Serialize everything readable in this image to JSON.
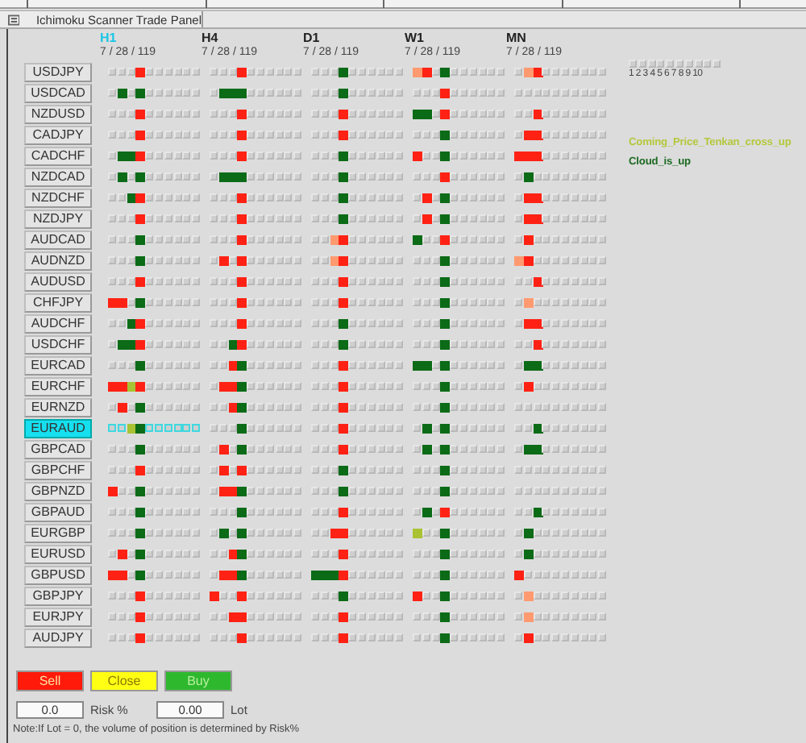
{
  "window": {
    "title": "Ichimoku Scanner Trade Panel"
  },
  "timeframes": [
    {
      "label": "H1",
      "selected": true,
      "periods": "7 / 28 / 119"
    },
    {
      "label": "H4",
      "selected": false,
      "periods": "7 / 28 / 119"
    },
    {
      "label": "D1",
      "selected": false,
      "periods": "7 / 28 / 119"
    },
    {
      "label": "W1",
      "selected": false,
      "periods": "7 / 28 / 119"
    },
    {
      "label": "MN",
      "selected": false,
      "periods": "7 / 28 / 119"
    }
  ],
  "legend": {
    "numbers": "1 2 3 4 5 6 7 8 9 10"
  },
  "signals": [
    {
      "label": "Coming_Price_Tenkan_cross_up",
      "color": "#b4c83c"
    },
    {
      "label": "Cloud_is_up",
      "color": "#1d6a22"
    }
  ],
  "pairs": [
    {
      "symbol": "USDJPY",
      "selected": false,
      "cells": [
        [
          {
            "kind": "off"
          },
          {
            "kind": "off"
          },
          {
            "kind": "off"
          },
          {
            "kind": "red"
          }
        ],
        [
          {
            "kind": "off"
          },
          {
            "kind": "off"
          },
          {
            "kind": "off"
          },
          {
            "kind": "red"
          }
        ],
        [
          {
            "kind": "off"
          },
          {
            "kind": "off"
          },
          {
            "kind": "off"
          },
          {
            "kind": "green"
          }
        ],
        [
          {
            "kind": "orange"
          },
          {
            "kind": "red"
          },
          {
            "kind": "off"
          },
          {
            "kind": "green"
          }
        ],
        [
          {
            "kind": "off"
          },
          {
            "kind": "orange"
          },
          {
            "kind": "red"
          },
          {
            "kind": "off"
          }
        ]
      ]
    },
    {
      "symbol": "USDCAD",
      "selected": false,
      "cells": [
        [
          {
            "kind": "off"
          },
          {
            "kind": "green"
          },
          {
            "kind": "off"
          },
          {
            "kind": "green"
          }
        ],
        [
          {
            "kind": "off"
          },
          {
            "kind": "green"
          },
          {
            "kind": "green"
          },
          {
            "kind": "green"
          }
        ],
        [
          {
            "kind": "off"
          },
          {
            "kind": "off"
          },
          {
            "kind": "off"
          },
          {
            "kind": "green"
          }
        ],
        [
          {
            "kind": "off"
          },
          {
            "kind": "off"
          },
          {
            "kind": "off"
          },
          {
            "kind": "red"
          }
        ],
        [
          {
            "kind": "off"
          },
          {
            "kind": "off"
          },
          {
            "kind": "off"
          },
          {
            "kind": "off"
          }
        ]
      ]
    },
    {
      "symbol": "NZDUSD",
      "selected": false,
      "cells": [
        [
          {
            "kind": "off"
          },
          {
            "kind": "off"
          },
          {
            "kind": "off"
          },
          {
            "kind": "red"
          }
        ],
        [
          {
            "kind": "off"
          },
          {
            "kind": "off"
          },
          {
            "kind": "off"
          },
          {
            "kind": "red"
          }
        ],
        [
          {
            "kind": "off"
          },
          {
            "kind": "off"
          },
          {
            "kind": "off"
          },
          {
            "kind": "red"
          }
        ],
        [
          {
            "kind": "green"
          },
          {
            "kind": "green"
          },
          {
            "kind": "off"
          },
          {
            "kind": "red"
          }
        ],
        [
          {
            "kind": "off"
          },
          {
            "kind": "off"
          },
          {
            "kind": "red"
          },
          {
            "kind": "off"
          }
        ]
      ]
    },
    {
      "symbol": "CADJPY",
      "selected": false,
      "cells": [
        [
          {
            "kind": "off"
          },
          {
            "kind": "off"
          },
          {
            "kind": "off"
          },
          {
            "kind": "red"
          }
        ],
        [
          {
            "kind": "off"
          },
          {
            "kind": "off"
          },
          {
            "kind": "off"
          },
          {
            "kind": "red"
          }
        ],
        [
          {
            "kind": "off"
          },
          {
            "kind": "off"
          },
          {
            "kind": "off"
          },
          {
            "kind": "red"
          }
        ],
        [
          {
            "kind": "off"
          },
          {
            "kind": "off"
          },
          {
            "kind": "off"
          },
          {
            "kind": "green"
          }
        ],
        [
          {
            "kind": "off"
          },
          {
            "kind": "red"
          },
          {
            "kind": "red"
          },
          {
            "kind": "off"
          }
        ]
      ]
    },
    {
      "symbol": "CADCHF",
      "selected": false,
      "cells": [
        [
          {
            "kind": "off"
          },
          {
            "kind": "green"
          },
          {
            "kind": "green"
          },
          {
            "kind": "red"
          }
        ],
        [
          {
            "kind": "off"
          },
          {
            "kind": "off"
          },
          {
            "kind": "off"
          },
          {
            "kind": "red"
          }
        ],
        [
          {
            "kind": "off"
          },
          {
            "kind": "off"
          },
          {
            "kind": "off"
          },
          {
            "kind": "green"
          }
        ],
        [
          {
            "kind": "red"
          },
          {
            "kind": "off"
          },
          {
            "kind": "off"
          },
          {
            "kind": "green"
          }
        ],
        [
          {
            "kind": "red"
          },
          {
            "kind": "red"
          },
          {
            "kind": "red"
          },
          {
            "kind": "off"
          }
        ]
      ]
    },
    {
      "symbol": "NZDCAD",
      "selected": false,
      "cells": [
        [
          {
            "kind": "off"
          },
          {
            "kind": "green"
          },
          {
            "kind": "off"
          },
          {
            "kind": "green"
          }
        ],
        [
          {
            "kind": "off"
          },
          {
            "kind": "green"
          },
          {
            "kind": "green"
          },
          {
            "kind": "green"
          }
        ],
        [
          {
            "kind": "off"
          },
          {
            "kind": "off"
          },
          {
            "kind": "off"
          },
          {
            "kind": "green"
          }
        ],
        [
          {
            "kind": "off"
          },
          {
            "kind": "off"
          },
          {
            "kind": "off"
          },
          {
            "kind": "red"
          }
        ],
        [
          {
            "kind": "off"
          },
          {
            "kind": "green"
          },
          {
            "kind": "off"
          },
          {
            "kind": "off"
          }
        ]
      ]
    },
    {
      "symbol": "NZDCHF",
      "selected": false,
      "cells": [
        [
          {
            "kind": "off"
          },
          {
            "kind": "off"
          },
          {
            "kind": "green"
          },
          {
            "kind": "red"
          }
        ],
        [
          {
            "kind": "off"
          },
          {
            "kind": "off"
          },
          {
            "kind": "off"
          },
          {
            "kind": "red"
          }
        ],
        [
          {
            "kind": "off"
          },
          {
            "kind": "off"
          },
          {
            "kind": "off"
          },
          {
            "kind": "green"
          }
        ],
        [
          {
            "kind": "off"
          },
          {
            "kind": "red"
          },
          {
            "kind": "off"
          },
          {
            "kind": "green"
          }
        ],
        [
          {
            "kind": "off"
          },
          {
            "kind": "red"
          },
          {
            "kind": "red"
          },
          {
            "kind": "off"
          }
        ]
      ]
    },
    {
      "symbol": "NZDJPY",
      "selected": false,
      "cells": [
        [
          {
            "kind": "off"
          },
          {
            "kind": "off"
          },
          {
            "kind": "off"
          },
          {
            "kind": "red"
          }
        ],
        [
          {
            "kind": "off"
          },
          {
            "kind": "off"
          },
          {
            "kind": "off"
          },
          {
            "kind": "red"
          }
        ],
        [
          {
            "kind": "off"
          },
          {
            "kind": "off"
          },
          {
            "kind": "off"
          },
          {
            "kind": "green"
          }
        ],
        [
          {
            "kind": "off"
          },
          {
            "kind": "red"
          },
          {
            "kind": "off"
          },
          {
            "kind": "green"
          }
        ],
        [
          {
            "kind": "off"
          },
          {
            "kind": "red"
          },
          {
            "kind": "red"
          },
          {
            "kind": "off"
          }
        ]
      ]
    },
    {
      "symbol": "AUDCAD",
      "selected": false,
      "cells": [
        [
          {
            "kind": "off"
          },
          {
            "kind": "off"
          },
          {
            "kind": "off"
          },
          {
            "kind": "green"
          }
        ],
        [
          {
            "kind": "off"
          },
          {
            "kind": "off"
          },
          {
            "kind": "off"
          },
          {
            "kind": "red"
          }
        ],
        [
          {
            "kind": "off"
          },
          {
            "kind": "off"
          },
          {
            "kind": "orange"
          },
          {
            "kind": "red"
          }
        ],
        [
          {
            "kind": "green"
          },
          {
            "kind": "off"
          },
          {
            "kind": "off"
          },
          {
            "kind": "red"
          }
        ],
        [
          {
            "kind": "off"
          },
          {
            "kind": "red"
          },
          {
            "kind": "off"
          },
          {
            "kind": "off"
          }
        ]
      ]
    },
    {
      "symbol": "AUDNZD",
      "selected": false,
      "cells": [
        [
          {
            "kind": "off"
          },
          {
            "kind": "off"
          },
          {
            "kind": "off"
          },
          {
            "kind": "green"
          }
        ],
        [
          {
            "kind": "off"
          },
          {
            "kind": "red"
          },
          {
            "kind": "off"
          },
          {
            "kind": "red"
          }
        ],
        [
          {
            "kind": "off"
          },
          {
            "kind": "off"
          },
          {
            "kind": "orange"
          },
          {
            "kind": "red"
          }
        ],
        [
          {
            "kind": "off"
          },
          {
            "kind": "off"
          },
          {
            "kind": "off"
          },
          {
            "kind": "green"
          }
        ],
        [
          {
            "kind": "orange"
          },
          {
            "kind": "red"
          },
          {
            "kind": "off"
          },
          {
            "kind": "off"
          }
        ]
      ]
    },
    {
      "symbol": "AUDUSD",
      "selected": false,
      "cells": [
        [
          {
            "kind": "off"
          },
          {
            "kind": "off"
          },
          {
            "kind": "off"
          },
          {
            "kind": "red"
          }
        ],
        [
          {
            "kind": "off"
          },
          {
            "kind": "off"
          },
          {
            "kind": "off"
          },
          {
            "kind": "red"
          }
        ],
        [
          {
            "kind": "off"
          },
          {
            "kind": "off"
          },
          {
            "kind": "off"
          },
          {
            "kind": "red"
          }
        ],
        [
          {
            "kind": "off"
          },
          {
            "kind": "off"
          },
          {
            "kind": "off"
          },
          {
            "kind": "green"
          }
        ],
        [
          {
            "kind": "off"
          },
          {
            "kind": "off"
          },
          {
            "kind": "red"
          },
          {
            "kind": "off"
          }
        ]
      ]
    },
    {
      "symbol": "CHFJPY",
      "selected": false,
      "cells": [
        [
          {
            "kind": "red"
          },
          {
            "kind": "red"
          },
          {
            "kind": "off"
          },
          {
            "kind": "green"
          }
        ],
        [
          {
            "kind": "off"
          },
          {
            "kind": "off"
          },
          {
            "kind": "off"
          },
          {
            "kind": "red"
          }
        ],
        [
          {
            "kind": "off"
          },
          {
            "kind": "off"
          },
          {
            "kind": "off"
          },
          {
            "kind": "red"
          }
        ],
        [
          {
            "kind": "off"
          },
          {
            "kind": "off"
          },
          {
            "kind": "off"
          },
          {
            "kind": "green"
          }
        ],
        [
          {
            "kind": "off"
          },
          {
            "kind": "orange"
          },
          {
            "kind": "off"
          },
          {
            "kind": "off"
          }
        ]
      ]
    },
    {
      "symbol": "AUDCHF",
      "selected": false,
      "cells": [
        [
          {
            "kind": "off"
          },
          {
            "kind": "off"
          },
          {
            "kind": "green"
          },
          {
            "kind": "red"
          }
        ],
        [
          {
            "kind": "off"
          },
          {
            "kind": "off"
          },
          {
            "kind": "off"
          },
          {
            "kind": "red"
          }
        ],
        [
          {
            "kind": "off"
          },
          {
            "kind": "off"
          },
          {
            "kind": "off"
          },
          {
            "kind": "green"
          }
        ],
        [
          {
            "kind": "off"
          },
          {
            "kind": "off"
          },
          {
            "kind": "off"
          },
          {
            "kind": "green"
          }
        ],
        [
          {
            "kind": "off"
          },
          {
            "kind": "red"
          },
          {
            "kind": "red"
          },
          {
            "kind": "off"
          }
        ]
      ]
    },
    {
      "symbol": "USDCHF",
      "selected": false,
      "cells": [
        [
          {
            "kind": "off"
          },
          {
            "kind": "green"
          },
          {
            "kind": "green"
          },
          {
            "kind": "red"
          }
        ],
        [
          {
            "kind": "off"
          },
          {
            "kind": "off"
          },
          {
            "kind": "green"
          },
          {
            "kind": "red"
          }
        ],
        [
          {
            "kind": "off"
          },
          {
            "kind": "off"
          },
          {
            "kind": "off"
          },
          {
            "kind": "green"
          }
        ],
        [
          {
            "kind": "off"
          },
          {
            "kind": "off"
          },
          {
            "kind": "off"
          },
          {
            "kind": "green"
          }
        ],
        [
          {
            "kind": "off"
          },
          {
            "kind": "off"
          },
          {
            "kind": "red"
          },
          {
            "kind": "off"
          }
        ]
      ]
    },
    {
      "symbol": "EURCAD",
      "selected": false,
      "cells": [
        [
          {
            "kind": "off"
          },
          {
            "kind": "off"
          },
          {
            "kind": "off"
          },
          {
            "kind": "green"
          }
        ],
        [
          {
            "kind": "off"
          },
          {
            "kind": "off"
          },
          {
            "kind": "red"
          },
          {
            "kind": "green"
          }
        ],
        [
          {
            "kind": "off"
          },
          {
            "kind": "off"
          },
          {
            "kind": "off"
          },
          {
            "kind": "red"
          }
        ],
        [
          {
            "kind": "green"
          },
          {
            "kind": "green"
          },
          {
            "kind": "off"
          },
          {
            "kind": "green"
          }
        ],
        [
          {
            "kind": "off"
          },
          {
            "kind": "green"
          },
          {
            "kind": "green"
          },
          {
            "kind": "off"
          }
        ]
      ]
    },
    {
      "symbol": "EURCHF",
      "selected": false,
      "cells": [
        [
          {
            "kind": "red"
          },
          {
            "kind": "red"
          },
          {
            "kind": "lime"
          },
          {
            "kind": "red"
          }
        ],
        [
          {
            "kind": "off"
          },
          {
            "kind": "red"
          },
          {
            "kind": "red"
          },
          {
            "kind": "green"
          }
        ],
        [
          {
            "kind": "off"
          },
          {
            "kind": "off"
          },
          {
            "kind": "off"
          },
          {
            "kind": "red"
          }
        ],
        [
          {
            "kind": "off"
          },
          {
            "kind": "off"
          },
          {
            "kind": "off"
          },
          {
            "kind": "green"
          }
        ],
        [
          {
            "kind": "off"
          },
          {
            "kind": "red"
          },
          {
            "kind": "off"
          },
          {
            "kind": "off"
          }
        ]
      ]
    },
    {
      "symbol": "EURNZD",
      "selected": false,
      "cells": [
        [
          {
            "kind": "off"
          },
          {
            "kind": "red"
          },
          {
            "kind": "off"
          },
          {
            "kind": "green"
          }
        ],
        [
          {
            "kind": "off"
          },
          {
            "kind": "off"
          },
          {
            "kind": "red"
          },
          {
            "kind": "green"
          }
        ],
        [
          {
            "kind": "off"
          },
          {
            "kind": "off"
          },
          {
            "kind": "off"
          },
          {
            "kind": "red"
          }
        ],
        [
          {
            "kind": "off"
          },
          {
            "kind": "off"
          },
          {
            "kind": "off"
          },
          {
            "kind": "green"
          }
        ],
        [
          {
            "kind": "off"
          },
          {
            "kind": "off"
          },
          {
            "kind": "off"
          },
          {
            "kind": "off"
          }
        ]
      ]
    },
    {
      "symbol": "EURAUD",
      "selected": true,
      "cells": [
        [
          {
            "kind": "off"
          },
          {
            "kind": "off"
          },
          {
            "kind": "lime"
          },
          {
            "kind": "green"
          }
        ],
        [
          {
            "kind": "off"
          },
          {
            "kind": "off"
          },
          {
            "kind": "off"
          },
          {
            "kind": "green"
          }
        ],
        [
          {
            "kind": "off"
          },
          {
            "kind": "off"
          },
          {
            "kind": "off"
          },
          {
            "kind": "red"
          }
        ],
        [
          {
            "kind": "off"
          },
          {
            "kind": "green"
          },
          {
            "kind": "off"
          },
          {
            "kind": "green"
          }
        ],
        [
          {
            "kind": "off"
          },
          {
            "kind": "off"
          },
          {
            "kind": "green"
          },
          {
            "kind": "off"
          }
        ]
      ]
    },
    {
      "symbol": "GBPCAD",
      "selected": false,
      "cells": [
        [
          {
            "kind": "off"
          },
          {
            "kind": "off"
          },
          {
            "kind": "off"
          },
          {
            "kind": "green"
          }
        ],
        [
          {
            "kind": "off"
          },
          {
            "kind": "red"
          },
          {
            "kind": "off"
          },
          {
            "kind": "green"
          }
        ],
        [
          {
            "kind": "off"
          },
          {
            "kind": "off"
          },
          {
            "kind": "off"
          },
          {
            "kind": "red"
          }
        ],
        [
          {
            "kind": "off"
          },
          {
            "kind": "green"
          },
          {
            "kind": "off"
          },
          {
            "kind": "green"
          }
        ],
        [
          {
            "kind": "off"
          },
          {
            "kind": "green"
          },
          {
            "kind": "green"
          },
          {
            "kind": "off"
          }
        ]
      ]
    },
    {
      "symbol": "GBPCHF",
      "selected": false,
      "cells": [
        [
          {
            "kind": "off"
          },
          {
            "kind": "off"
          },
          {
            "kind": "off"
          },
          {
            "kind": "red"
          }
        ],
        [
          {
            "kind": "off"
          },
          {
            "kind": "red"
          },
          {
            "kind": "off"
          },
          {
            "kind": "red"
          }
        ],
        [
          {
            "kind": "off"
          },
          {
            "kind": "off"
          },
          {
            "kind": "off"
          },
          {
            "kind": "green"
          }
        ],
        [
          {
            "kind": "off"
          },
          {
            "kind": "off"
          },
          {
            "kind": "off"
          },
          {
            "kind": "green"
          }
        ],
        [
          {
            "kind": "off"
          },
          {
            "kind": "off"
          },
          {
            "kind": "off"
          },
          {
            "kind": "off"
          }
        ]
      ]
    },
    {
      "symbol": "GBPNZD",
      "selected": false,
      "cells": [
        [
          {
            "kind": "red"
          },
          {
            "kind": "off"
          },
          {
            "kind": "off"
          },
          {
            "kind": "green"
          }
        ],
        [
          {
            "kind": "off"
          },
          {
            "kind": "red"
          },
          {
            "kind": "red"
          },
          {
            "kind": "green"
          }
        ],
        [
          {
            "kind": "off"
          },
          {
            "kind": "off"
          },
          {
            "kind": "off"
          },
          {
            "kind": "green"
          }
        ],
        [
          {
            "kind": "off"
          },
          {
            "kind": "off"
          },
          {
            "kind": "off"
          },
          {
            "kind": "green"
          }
        ],
        [
          {
            "kind": "off"
          },
          {
            "kind": "off"
          },
          {
            "kind": "off"
          },
          {
            "kind": "off"
          }
        ]
      ]
    },
    {
      "symbol": "GBPAUD",
      "selected": false,
      "cells": [
        [
          {
            "kind": "off"
          },
          {
            "kind": "off"
          },
          {
            "kind": "off"
          },
          {
            "kind": "green"
          }
        ],
        [
          {
            "kind": "off"
          },
          {
            "kind": "off"
          },
          {
            "kind": "off"
          },
          {
            "kind": "green"
          }
        ],
        [
          {
            "kind": "off"
          },
          {
            "kind": "off"
          },
          {
            "kind": "off"
          },
          {
            "kind": "red"
          }
        ],
        [
          {
            "kind": "off"
          },
          {
            "kind": "green"
          },
          {
            "kind": "off"
          },
          {
            "kind": "red"
          }
        ],
        [
          {
            "kind": "off"
          },
          {
            "kind": "off"
          },
          {
            "kind": "green"
          },
          {
            "kind": "off"
          }
        ]
      ]
    },
    {
      "symbol": "EURGBP",
      "selected": false,
      "cells": [
        [
          {
            "kind": "off"
          },
          {
            "kind": "off"
          },
          {
            "kind": "off"
          },
          {
            "kind": "green"
          }
        ],
        [
          {
            "kind": "off"
          },
          {
            "kind": "green"
          },
          {
            "kind": "off"
          },
          {
            "kind": "green"
          }
        ],
        [
          {
            "kind": "off"
          },
          {
            "kind": "off"
          },
          {
            "kind": "red"
          },
          {
            "kind": "red"
          }
        ],
        [
          {
            "kind": "lime"
          },
          {
            "kind": "off"
          },
          {
            "kind": "off"
          },
          {
            "kind": "green"
          }
        ],
        [
          {
            "kind": "off"
          },
          {
            "kind": "green"
          },
          {
            "kind": "off"
          },
          {
            "kind": "off"
          }
        ]
      ]
    },
    {
      "symbol": "EURUSD",
      "selected": false,
      "cells": [
        [
          {
            "kind": "off"
          },
          {
            "kind": "red"
          },
          {
            "kind": "off"
          },
          {
            "kind": "green"
          }
        ],
        [
          {
            "kind": "off"
          },
          {
            "kind": "off"
          },
          {
            "kind": "red"
          },
          {
            "kind": "green"
          }
        ],
        [
          {
            "kind": "off"
          },
          {
            "kind": "off"
          },
          {
            "kind": "off"
          },
          {
            "kind": "red"
          }
        ],
        [
          {
            "kind": "off"
          },
          {
            "kind": "off"
          },
          {
            "kind": "off"
          },
          {
            "kind": "green"
          }
        ],
        [
          {
            "kind": "off"
          },
          {
            "kind": "green"
          },
          {
            "kind": "off"
          },
          {
            "kind": "off"
          }
        ]
      ]
    },
    {
      "symbol": "GBPUSD",
      "selected": false,
      "cells": [
        [
          {
            "kind": "red"
          },
          {
            "kind": "red"
          },
          {
            "kind": "off"
          },
          {
            "kind": "green"
          }
        ],
        [
          {
            "kind": "off"
          },
          {
            "kind": "red"
          },
          {
            "kind": "red"
          },
          {
            "kind": "green"
          }
        ],
        [
          {
            "kind": "green"
          },
          {
            "kind": "green"
          },
          {
            "kind": "green"
          },
          {
            "kind": "red"
          }
        ],
        [
          {
            "kind": "off"
          },
          {
            "kind": "off"
          },
          {
            "kind": "off"
          },
          {
            "kind": "green"
          }
        ],
        [
          {
            "kind": "red"
          },
          {
            "kind": "off"
          },
          {
            "kind": "off"
          },
          {
            "kind": "off"
          }
        ]
      ]
    },
    {
      "symbol": "GBPJPY",
      "selected": false,
      "cells": [
        [
          {
            "kind": "off"
          },
          {
            "kind": "off"
          },
          {
            "kind": "off"
          },
          {
            "kind": "red"
          }
        ],
        [
          {
            "kind": "red"
          },
          {
            "kind": "off"
          },
          {
            "kind": "off"
          },
          {
            "kind": "red"
          }
        ],
        [
          {
            "kind": "off"
          },
          {
            "kind": "off"
          },
          {
            "kind": "off"
          },
          {
            "kind": "green"
          }
        ],
        [
          {
            "kind": "red"
          },
          {
            "kind": "off"
          },
          {
            "kind": "off"
          },
          {
            "kind": "green"
          }
        ],
        [
          {
            "kind": "off"
          },
          {
            "kind": "orange"
          },
          {
            "kind": "off"
          },
          {
            "kind": "off"
          }
        ]
      ]
    },
    {
      "symbol": "EURJPY",
      "selected": false,
      "cells": [
        [
          {
            "kind": "off"
          },
          {
            "kind": "off"
          },
          {
            "kind": "off"
          },
          {
            "kind": "red"
          }
        ],
        [
          {
            "kind": "off"
          },
          {
            "kind": "off"
          },
          {
            "kind": "red"
          },
          {
            "kind": "red"
          }
        ],
        [
          {
            "kind": "off"
          },
          {
            "kind": "off"
          },
          {
            "kind": "off"
          },
          {
            "kind": "red"
          }
        ],
        [
          {
            "kind": "off"
          },
          {
            "kind": "off"
          },
          {
            "kind": "off"
          },
          {
            "kind": "green"
          }
        ],
        [
          {
            "kind": "off"
          },
          {
            "kind": "orange"
          },
          {
            "kind": "off"
          },
          {
            "kind": "off"
          }
        ]
      ]
    },
    {
      "symbol": "AUDJPY",
      "selected": false,
      "cells": [
        [
          {
            "kind": "off"
          },
          {
            "kind": "off"
          },
          {
            "kind": "off"
          },
          {
            "kind": "red"
          }
        ],
        [
          {
            "kind": "off"
          },
          {
            "kind": "off"
          },
          {
            "kind": "off"
          },
          {
            "kind": "red"
          }
        ],
        [
          {
            "kind": "off"
          },
          {
            "kind": "off"
          },
          {
            "kind": "off"
          },
          {
            "kind": "red"
          }
        ],
        [
          {
            "kind": "off"
          },
          {
            "kind": "off"
          },
          {
            "kind": "off"
          },
          {
            "kind": "green"
          }
        ],
        [
          {
            "kind": "off"
          },
          {
            "kind": "red"
          },
          {
            "kind": "off"
          },
          {
            "kind": "off"
          }
        ]
      ]
    }
  ],
  "buttons": [
    {
      "label": "Sell",
      "kind": "sell"
    },
    {
      "label": "Close",
      "kind": "close"
    },
    {
      "label": "Buy",
      "kind": "buy"
    }
  ],
  "risk": {
    "value": "0.0",
    "label": "Risk %"
  },
  "lot": {
    "value": "0.00",
    "label": "Lot"
  },
  "note": "Note:If Lot = 0, the volume of position is determined by Risk%"
}
